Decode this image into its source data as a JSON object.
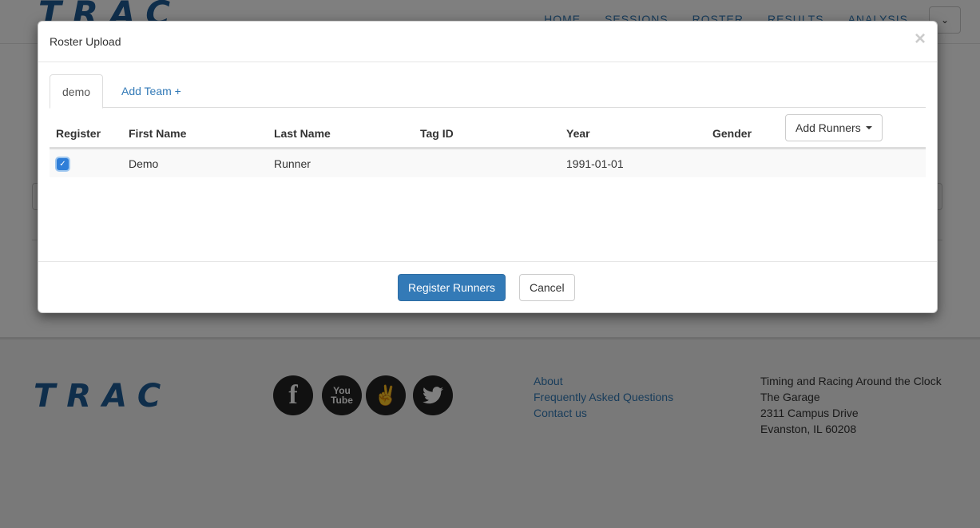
{
  "navbar": {
    "logo": "TRAC",
    "links": [
      "HOME",
      "SESSIONS",
      "ROSTER",
      "RESULTS",
      "ANALYSIS"
    ]
  },
  "footer": {
    "logo": "TRAC",
    "social": [
      {
        "icon": "facebook-icon",
        "glyph": "f"
      },
      {
        "icon": "youtube-icon",
        "glyph": "You\nTube"
      },
      {
        "icon": "angellist-icon",
        "glyph": "✌"
      },
      {
        "icon": "twitter-icon",
        "glyph": "🐦"
      }
    ],
    "links": [
      "About",
      "Frequently Asked Questions",
      "Contact us"
    ],
    "address": [
      "Timing and Racing Around the Clock",
      "The Garage",
      "2311 Campus Drive",
      "Evanston, IL 60208"
    ]
  },
  "modal": {
    "title": "Roster Upload",
    "close": "×",
    "tabs": [
      {
        "label": "demo",
        "active": true
      },
      {
        "label": "Add Team +",
        "active": false
      }
    ],
    "columns": [
      "Register",
      "First Name",
      "Last Name",
      "Tag ID",
      "Year",
      "Gender"
    ],
    "add_runners_label": "Add Runners",
    "rows": [
      {
        "register": true,
        "first_name": "Demo",
        "last_name": "Runner",
        "tag_id": "",
        "year": "1991-01-01",
        "gender": ""
      }
    ],
    "primary_button": "Register Runners",
    "cancel_button": "Cancel"
  },
  "colors": {
    "brand": "#1f5c96",
    "link": "#337ab7",
    "primary": "#337ab7",
    "backdrop": "rgba(0,0,0,0.5)"
  }
}
